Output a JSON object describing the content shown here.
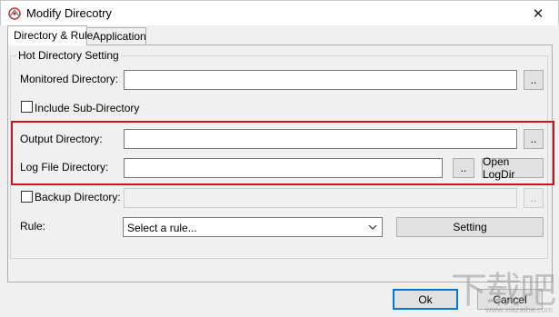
{
  "window": {
    "title": "Modify Direcotry",
    "close_glyph": "✕"
  },
  "tabs": [
    {
      "label": "Directory & Rule",
      "active": true
    },
    {
      "label": "Application",
      "active": false
    }
  ],
  "group": {
    "legend": "Hot Directory Setting"
  },
  "monitored": {
    "label": "Monitored Directory:",
    "value": "",
    "browse_label": ".."
  },
  "include_sub": {
    "label": "Include Sub-Directory",
    "checked": false
  },
  "output": {
    "label": "Output Directory:",
    "value": "",
    "browse_label": ".."
  },
  "log": {
    "label": "Log File Directory:",
    "value": "",
    "browse_label": "..",
    "open_label": "Open LogDir"
  },
  "backup": {
    "label": "Backup Directory:",
    "checked": false,
    "value": "",
    "browse_label": ".."
  },
  "rule": {
    "label": "Rule:",
    "selected": "Select a rule...",
    "setting_label": "Setting"
  },
  "footer": {
    "ok_label": "Ok",
    "cancel_label": "Cancel"
  },
  "watermark": {
    "text": "下载吧",
    "url": "www.xiazaiba.com"
  },
  "colors": {
    "highlight": "#c8161d",
    "focus": "#0078d7"
  },
  "icons": {
    "app": "app-icon",
    "close": "close-icon",
    "dropdown": "chevron-down-icon"
  }
}
